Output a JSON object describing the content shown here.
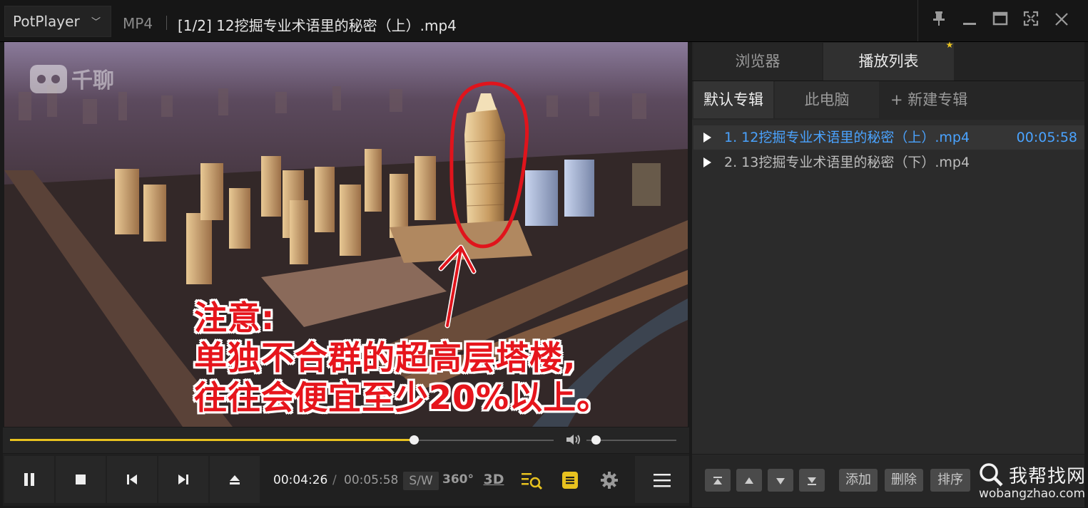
{
  "window": {
    "app_name": "PotPlayer",
    "app_menu_icon": "chevron-down-icon",
    "format": "MP4",
    "title": "[1/2] 12挖掘专业术语里的秘密（上）.mp4",
    "controls": {
      "pin_icon": "pin-icon",
      "minimize_icon": "minimize-icon",
      "maximize_icon": "maximize-icon",
      "fullscreen_icon": "fullscreen-icon",
      "close_icon": "close-icon"
    }
  },
  "video": {
    "watermark": "千聊",
    "subtitle_lines": [
      "注意:",
      "单独不合群的超高层塔楼,",
      "往往会便宜至少20%以上。"
    ]
  },
  "playback": {
    "position_seconds": 266,
    "duration_seconds": 358,
    "progress": 0.743,
    "volume": 0.1,
    "current_time": "00:04:26",
    "separator": "/",
    "total_time": "00:05:58",
    "sw_label": "S/W",
    "label_360": "360°",
    "label_3d": "3D"
  },
  "controls": {
    "pause_icon": "pause-icon",
    "stop_icon": "stop-icon",
    "prev_icon": "skip-previous-icon",
    "next_icon": "skip-next-icon",
    "eject_icon": "eject-icon",
    "search_icon": "playlist-search-icon",
    "subtitle_icon": "subtitle-icon",
    "settings_icon": "gear-icon",
    "menu_icon": "hamburger-menu-icon",
    "volume_icon": "speaker-icon",
    "accent_color": "#e8c21f"
  },
  "panel": {
    "tabs": [
      {
        "label": "浏览器",
        "active": false
      },
      {
        "label": "播放列表",
        "active": true
      }
    ],
    "subtabs": [
      {
        "label": "默认专辑",
        "active": true
      },
      {
        "label": "此电脑",
        "active": false
      },
      {
        "label": "+ 新建专辑",
        "active": false
      }
    ],
    "playlist": [
      {
        "name": "1. 12挖掘专业术语里的秘密（上）.mp4",
        "duration": "00:05:58",
        "playing": true,
        "color": "#4aa3ff"
      },
      {
        "name": "2. 13挖掘专业术语里的秘密（下）.mp4",
        "duration": "",
        "playing": false,
        "color": "#bdbdbd"
      }
    ],
    "bottom_icons": [
      "move-to-top-icon",
      "move-up-icon",
      "move-down-icon",
      "move-to-bottom-icon"
    ],
    "bottom_buttons": {
      "add": "添加",
      "delete": "删除",
      "sort": "排序"
    }
  },
  "site_watermark": {
    "name": "我帮找网",
    "url": "wobangzhao.com"
  }
}
